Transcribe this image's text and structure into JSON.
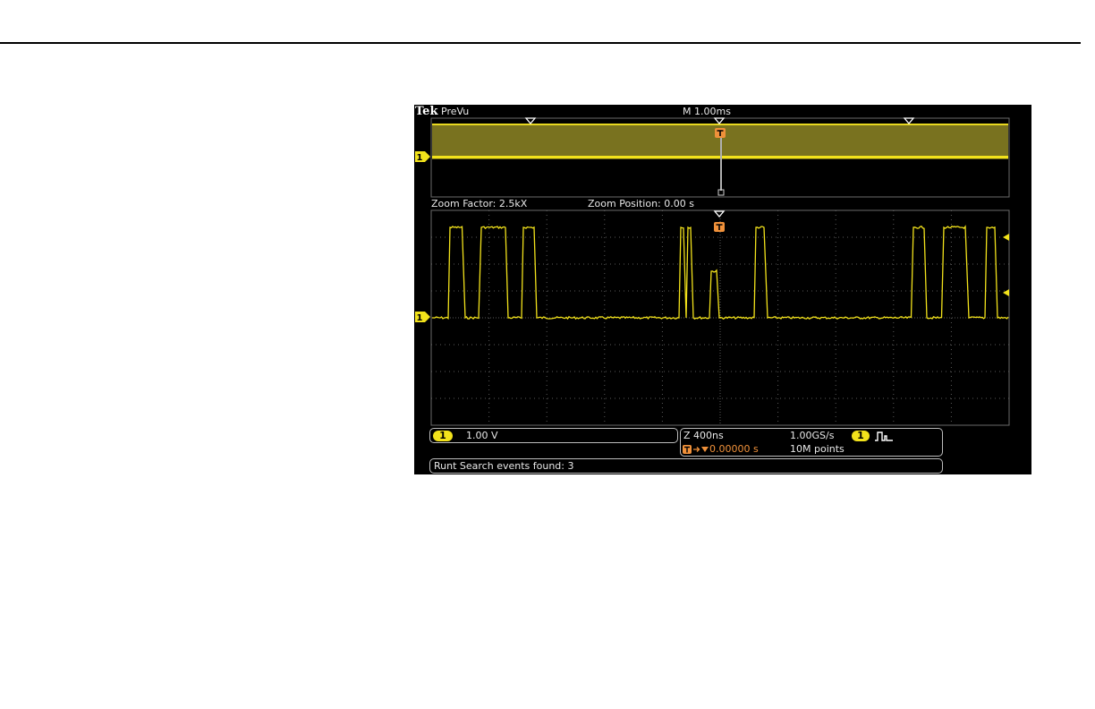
{
  "header": {
    "brand": "Tek",
    "mode": "PreVu",
    "timebase": "M 1.00ms"
  },
  "zoom": {
    "factor": "Zoom Factor: 2.5kX",
    "position": "Zoom Position: 0.00 s"
  },
  "channel": {
    "id": "1",
    "scale": "1.00 V"
  },
  "acquisition": {
    "zoom_timebase": "Z 400ns",
    "sample_rate": "1.00GS/s",
    "record_length": "10M points",
    "trigger_position": "0.00000 s",
    "trigger_channel": "1"
  },
  "status": {
    "message": "Runt Search events found: 3"
  },
  "colors": {
    "trace": "#f2e21b",
    "trigger": "#f0913a",
    "grid": "#5a5a5a",
    "background": "#000000"
  },
  "icons": [
    "trigger-marker-icon",
    "search-mark-icon",
    "channel-marker-icon",
    "pulse-trigger-icon",
    "threshold-arrow-icon"
  ]
}
